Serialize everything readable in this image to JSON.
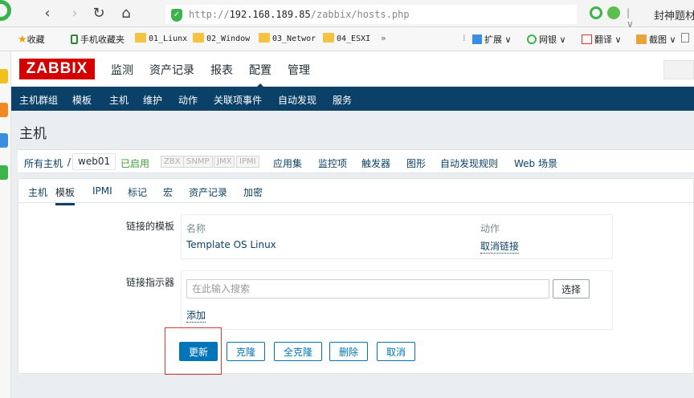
{
  "browser": {
    "url_prefix": "http://",
    "url_host": "192.168.189.85",
    "url_path": "/zabbix/hosts.php",
    "right_text": "封神题材"
  },
  "bookmarks": [
    {
      "label": "收藏",
      "icon": "star-icon"
    },
    {
      "label": "手机收藏夹",
      "icon": "phone-icon"
    },
    {
      "label": "01_Liunx",
      "icon": "folder-icon"
    },
    {
      "label": "02_Window",
      "icon": "folder-icon"
    },
    {
      "label": "03_Networ",
      "icon": "folder-icon"
    },
    {
      "label": "04_ESXI",
      "icon": "folder-icon"
    }
  ],
  "bookmarks_more": "»",
  "bookmark_tools": [
    {
      "label": "扩展"
    },
    {
      "label": "网银"
    },
    {
      "label": "翻译"
    },
    {
      "label": "截图"
    }
  ],
  "zabbix": {
    "logo": "ZABBIX",
    "top_menu": [
      "监测",
      "资产记录",
      "报表",
      "配置",
      "管理"
    ],
    "sub_menu": [
      "主机群组",
      "模板",
      "主机",
      "维护",
      "动作",
      "关联项事件",
      "自动发现",
      "服务"
    ],
    "page_title": "主机",
    "host_nav": {
      "all_hosts": "所有主机",
      "separator": "/",
      "current_host": "web01",
      "status": "已启用",
      "badges": [
        "ZBX",
        "SNMP",
        "JMX",
        "IPMI"
      ],
      "links": [
        "应用集",
        "监控项",
        "触发器",
        "图形",
        "自动发现规则",
        "Web 场景"
      ]
    },
    "tabs": [
      "主机",
      "模板",
      "IPMI",
      "标记",
      "宏",
      "资产记录",
      "加密"
    ],
    "linked_templates_label": "链接的模板",
    "linked_templates": {
      "col_name": "名称",
      "col_action": "动作",
      "rows": [
        {
          "name": "Template OS Linux",
          "action": "取消链接"
        }
      ]
    },
    "link_indicator_label": "链接指示器",
    "search_placeholder": "在此输入搜索",
    "select_button": "选择",
    "add_link": "添加",
    "buttons": {
      "update": "更新",
      "clone": "克隆",
      "full_clone": "全克隆",
      "delete": "删除",
      "cancel": "取消"
    }
  },
  "colors": {
    "brand_red": "#d40000",
    "nav_blue": "#0b4168",
    "button_blue": "#0275b8",
    "enabled_green": "#3f9c35",
    "highlight_red": "#d43c3c"
  }
}
